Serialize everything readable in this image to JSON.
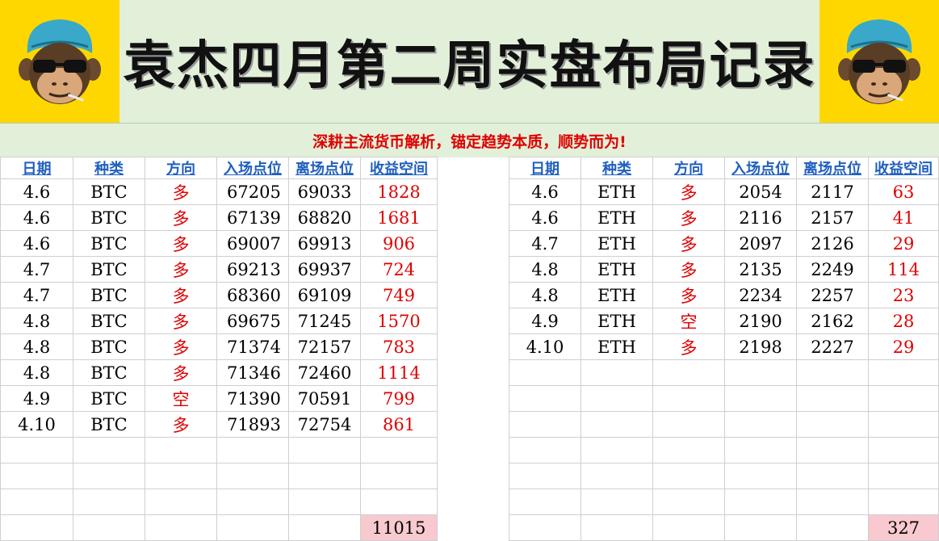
{
  "title": "袁杰四月第二周实盘布局记录",
  "slogan": "深耕主流货币解析，锚定趋势本质，顺势而为!",
  "logo": {
    "icon": "monkey-with-sunglasses-icon"
  },
  "headers": [
    "日期",
    "种类",
    "方向",
    "入场点位",
    "离场点位",
    "收益空间"
  ],
  "btc_rows": [
    {
      "date": "4.6",
      "coin": "BTC",
      "dir": "多",
      "entry": "67205",
      "exit": "69033",
      "profit": "1828"
    },
    {
      "date": "4.6",
      "coin": "BTC",
      "dir": "多",
      "entry": "67139",
      "exit": "68820",
      "profit": "1681"
    },
    {
      "date": "4.6",
      "coin": "BTC",
      "dir": "多",
      "entry": "69007",
      "exit": "69913",
      "profit": "906"
    },
    {
      "date": "4.7",
      "coin": "BTC",
      "dir": "多",
      "entry": "69213",
      "exit": "69937",
      "profit": "724"
    },
    {
      "date": "4.7",
      "coin": "BTC",
      "dir": "多",
      "entry": "68360",
      "exit": "69109",
      "profit": "749"
    },
    {
      "date": "4.8",
      "coin": "BTC",
      "dir": "多",
      "entry": "69675",
      "exit": "71245",
      "profit": "1570"
    },
    {
      "date": "4.8",
      "coin": "BTC",
      "dir": "多",
      "entry": "71374",
      "exit": "72157",
      "profit": "783"
    },
    {
      "date": "4.8",
      "coin": "BTC",
      "dir": "多",
      "entry": "71346",
      "exit": "72460",
      "profit": "1114"
    },
    {
      "date": "4.9",
      "coin": "BTC",
      "dir": "空",
      "entry": "71390",
      "exit": "70591",
      "profit": "799"
    },
    {
      "date": "4.10",
      "coin": "BTC",
      "dir": "多",
      "entry": "71893",
      "exit": "72754",
      "profit": "861"
    }
  ],
  "eth_rows": [
    {
      "date": "4.6",
      "coin": "ETH",
      "dir": "多",
      "entry": "2054",
      "exit": "2117",
      "profit": "63"
    },
    {
      "date": "4.6",
      "coin": "ETH",
      "dir": "多",
      "entry": "2116",
      "exit": "2157",
      "profit": "41"
    },
    {
      "date": "4.7",
      "coin": "ETH",
      "dir": "多",
      "entry": "2097",
      "exit": "2126",
      "profit": "29"
    },
    {
      "date": "4.8",
      "coin": "ETH",
      "dir": "多",
      "entry": "2135",
      "exit": "2249",
      "profit": "114"
    },
    {
      "date": "4.8",
      "coin": "ETH",
      "dir": "多",
      "entry": "2234",
      "exit": "2257",
      "profit": "23"
    },
    {
      "date": "4.9",
      "coin": "ETH",
      "dir": "空",
      "entry": "2190",
      "exit": "2162",
      "profit": "28"
    },
    {
      "date": "4.10",
      "coin": "ETH",
      "dir": "多",
      "entry": "2198",
      "exit": "2227",
      "profit": "29"
    }
  ],
  "btc_total": "11015",
  "eth_total": "327",
  "colors": {
    "banner_bg": "#e2f0d9",
    "logo_bg": "#ffd700",
    "header_link": "#1f5fbf",
    "highlight_red": "#e00000",
    "total_bg": "#f8c9cf"
  }
}
